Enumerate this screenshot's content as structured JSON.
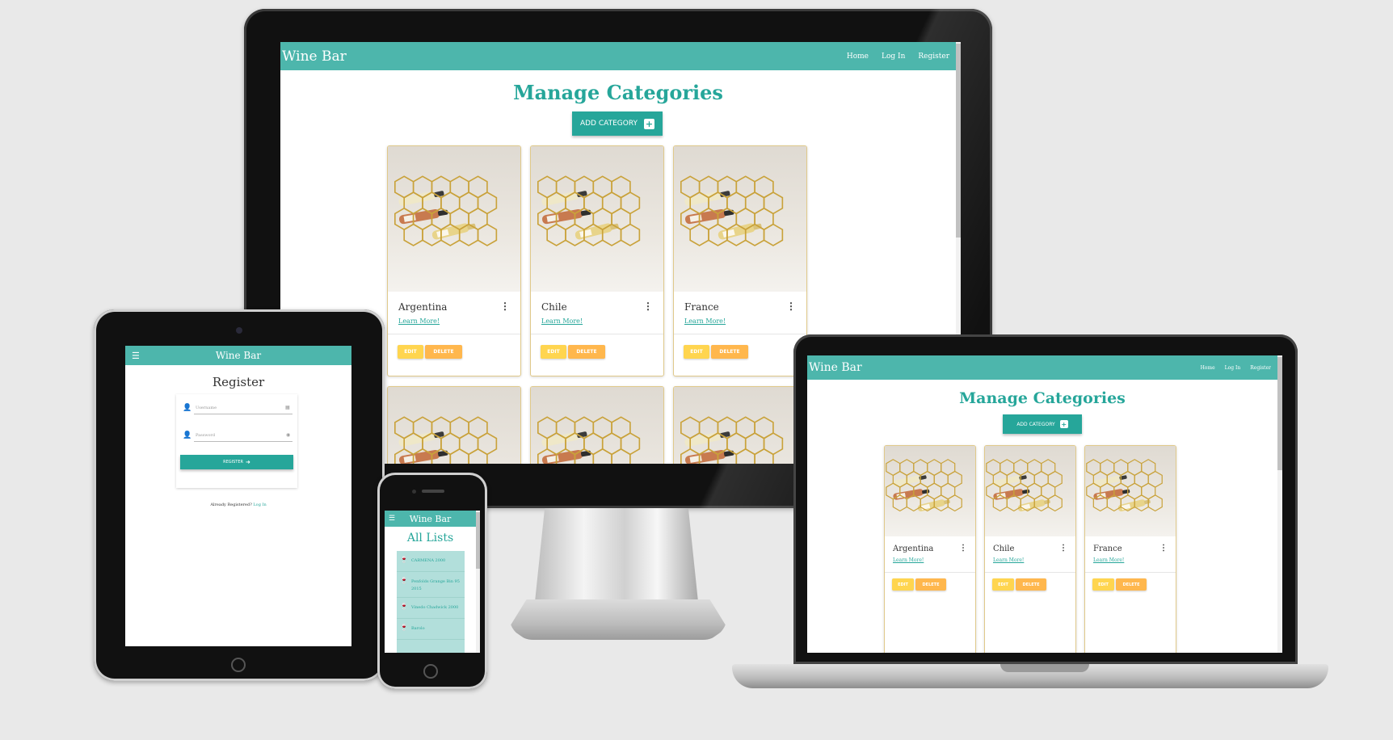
{
  "app": {
    "brand": "Wine Bar",
    "nav": [
      "Home",
      "Log In",
      "Register"
    ]
  },
  "categories_page": {
    "title": "Manage Categories",
    "add_button": "ADD CATEGORY",
    "cards": [
      {
        "title": "Argentina",
        "link": "Learn More!",
        "edit": "EDIT",
        "delete": "DELETE"
      },
      {
        "title": "Chile",
        "link": "Learn More!",
        "edit": "EDIT",
        "delete": "DELETE"
      },
      {
        "title": "France",
        "link": "Learn More!",
        "edit": "EDIT",
        "delete": "DELETE"
      }
    ]
  },
  "register_page": {
    "title": "Register",
    "username_placeholder": "Username",
    "password_placeholder": "Password",
    "submit": "REGISTER",
    "already_text": "Already Registered?",
    "login_link": "Log In"
  },
  "lists_page": {
    "title": "All Lists",
    "items": [
      "CARMENA 2000",
      "Penfolds Grange Bin 95 2015",
      "Vinedo Chadwick 2000",
      "Barolo"
    ]
  },
  "colors": {
    "primary": "#4db6ac",
    "primary_dark": "#26a69a",
    "edit": "#ffd54f",
    "delete": "#ffb74d",
    "list_bg": "#b2dfdb"
  }
}
